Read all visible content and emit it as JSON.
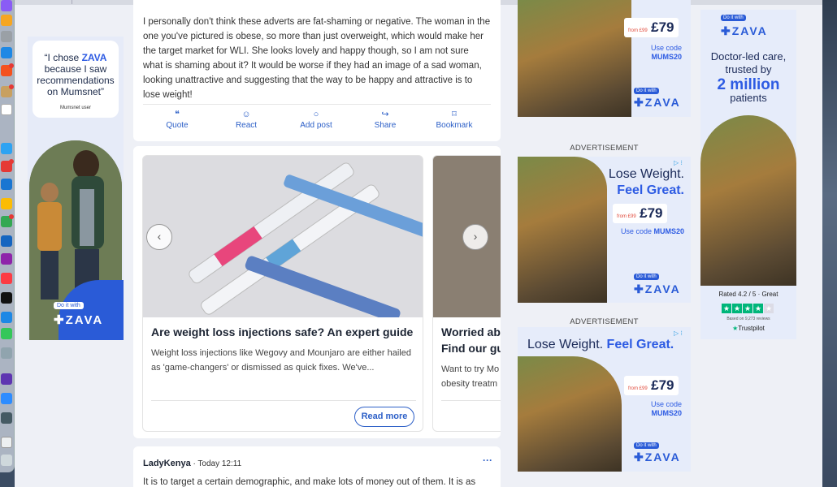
{
  "left_ad": {
    "quote_open": "“I chose ",
    "quote_brand": "ZAVA",
    "quote_rest": " because I saw recommendations on Mumsnet”",
    "quote_user": "Mumsnet user",
    "cta_small": "Do it with",
    "logo": "ZAVA"
  },
  "post": {
    "text": "I personally don't think these adverts are fat-shaming or negative. The woman in the one you've pictured is obese, so more than just overweight, which would make her the target market for WLI. She looks lovely and happy though, so I am not sure what is shaming about it? It would be worse if they had an image of a sad woman, looking unattractive and suggesting that the way to be happy and attractive is to lose weight!",
    "actions": {
      "quote": "Quote",
      "react": "React",
      "add_post": "Add post",
      "share": "Share",
      "bookmark": "Bookmark"
    }
  },
  "carousel": {
    "articles": [
      {
        "title": "Are weight loss injections safe? An expert guide",
        "description": "Weight loss injections like Wegovy and Mounjaro are either hailed as 'game-changers' or dismissed as quick fixes. We've...",
        "cta": "Read more"
      },
      {
        "title": "Worried ab",
        "title_line2": "Find our gu",
        "description": "Want to try Mo obesity treatm"
      }
    ],
    "prev_icon": "‹",
    "next_icon": "›"
  },
  "reply": {
    "author": "LadyKenya",
    "timestamp": " · Today 12:11",
    "more": "···",
    "text": "It is to target a certain demographic, and make lots of money out of them. It is as"
  },
  "right_ads": {
    "label": "ADVERTISEMENT",
    "price_from": "from £99",
    "price": "£79",
    "use_code": "Use code",
    "code": "MUMS20",
    "headline_1": "Lose Weight.",
    "headline_2": "Feel Great.",
    "cta_small": "Do it with",
    "logo": "ZAVA"
  },
  "far_ad": {
    "cta_small": "Do it with",
    "logo": "ZAVA",
    "tagline": "Doctor-led care, trusted by",
    "big": "2 million",
    "sub": "patients",
    "rating": "Rated 4.2 / 5 · Great",
    "reviews": "Based on 9,273 reviews",
    "trustpilot": "Trustpilot"
  },
  "colors": {
    "brand_blue": "#2d5be3",
    "link_blue": "#2c5fc7",
    "ad_bg": "#e6ecfa",
    "trustpilot_green": "#00b67a"
  }
}
